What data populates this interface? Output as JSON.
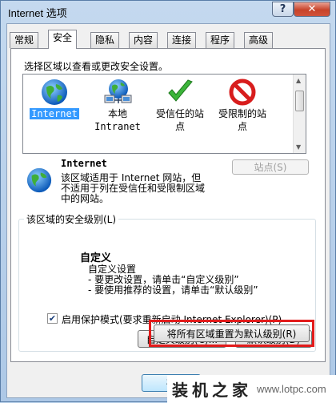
{
  "window": {
    "title": "Internet 选项",
    "help_glyph": "?",
    "close_glyph": "✕"
  },
  "tabs": [
    {
      "label": "常规"
    },
    {
      "label": "安全"
    },
    {
      "label": "隐私"
    },
    {
      "label": "内容"
    },
    {
      "label": "连接"
    },
    {
      "label": "程序"
    },
    {
      "label": "高级"
    }
  ],
  "active_tab": "安全",
  "security": {
    "zone_prompt": "选择区域以查看或更改安全设置。",
    "zones": [
      {
        "line1": "Internet",
        "line2": "",
        "icon": "globe-icon",
        "selected": true
      },
      {
        "line1": "本地",
        "line2": "Intranet",
        "icon": "local-intranet-icon",
        "selected": false
      },
      {
        "line1": "受信任的站",
        "line2": "点",
        "icon": "trusted-check-icon",
        "selected": false
      },
      {
        "line1": "受限制的站",
        "line2": "点",
        "icon": "restricted-no-icon",
        "selected": false
      }
    ],
    "selected_zone_name": "Internet",
    "selected_zone_desc": [
      "该区域适用于 Internet 网站，但",
      "不适用于列在受信任和受限制区域",
      "中的网站。"
    ],
    "sites_button": "站点(S)",
    "level_group_label": "该区域的安全级别(L)",
    "custom_title": "自定义",
    "custom_lines": [
      "自定义设置",
      "- 要更改设置，请单击“自定义级别”",
      "- 要使用推荐的设置，请单击“默认级别”"
    ],
    "protected_mode_label": "启用保护模式(要求重新启动 Internet Explorer)(P)",
    "protected_mode_checked": true,
    "custom_level_button": "自定义级别(C)...",
    "default_level_button": "默认级别(D)",
    "reset_all_button": "将所有区域重置为默认级别(R)"
  },
  "footer": {
    "ok_button": "确"
  },
  "watermark": {
    "text": "装机之家",
    "url": "www.lotpc.com"
  },
  "colors": {
    "highlight": "#e21b1b",
    "selection": "#3399ff"
  }
}
